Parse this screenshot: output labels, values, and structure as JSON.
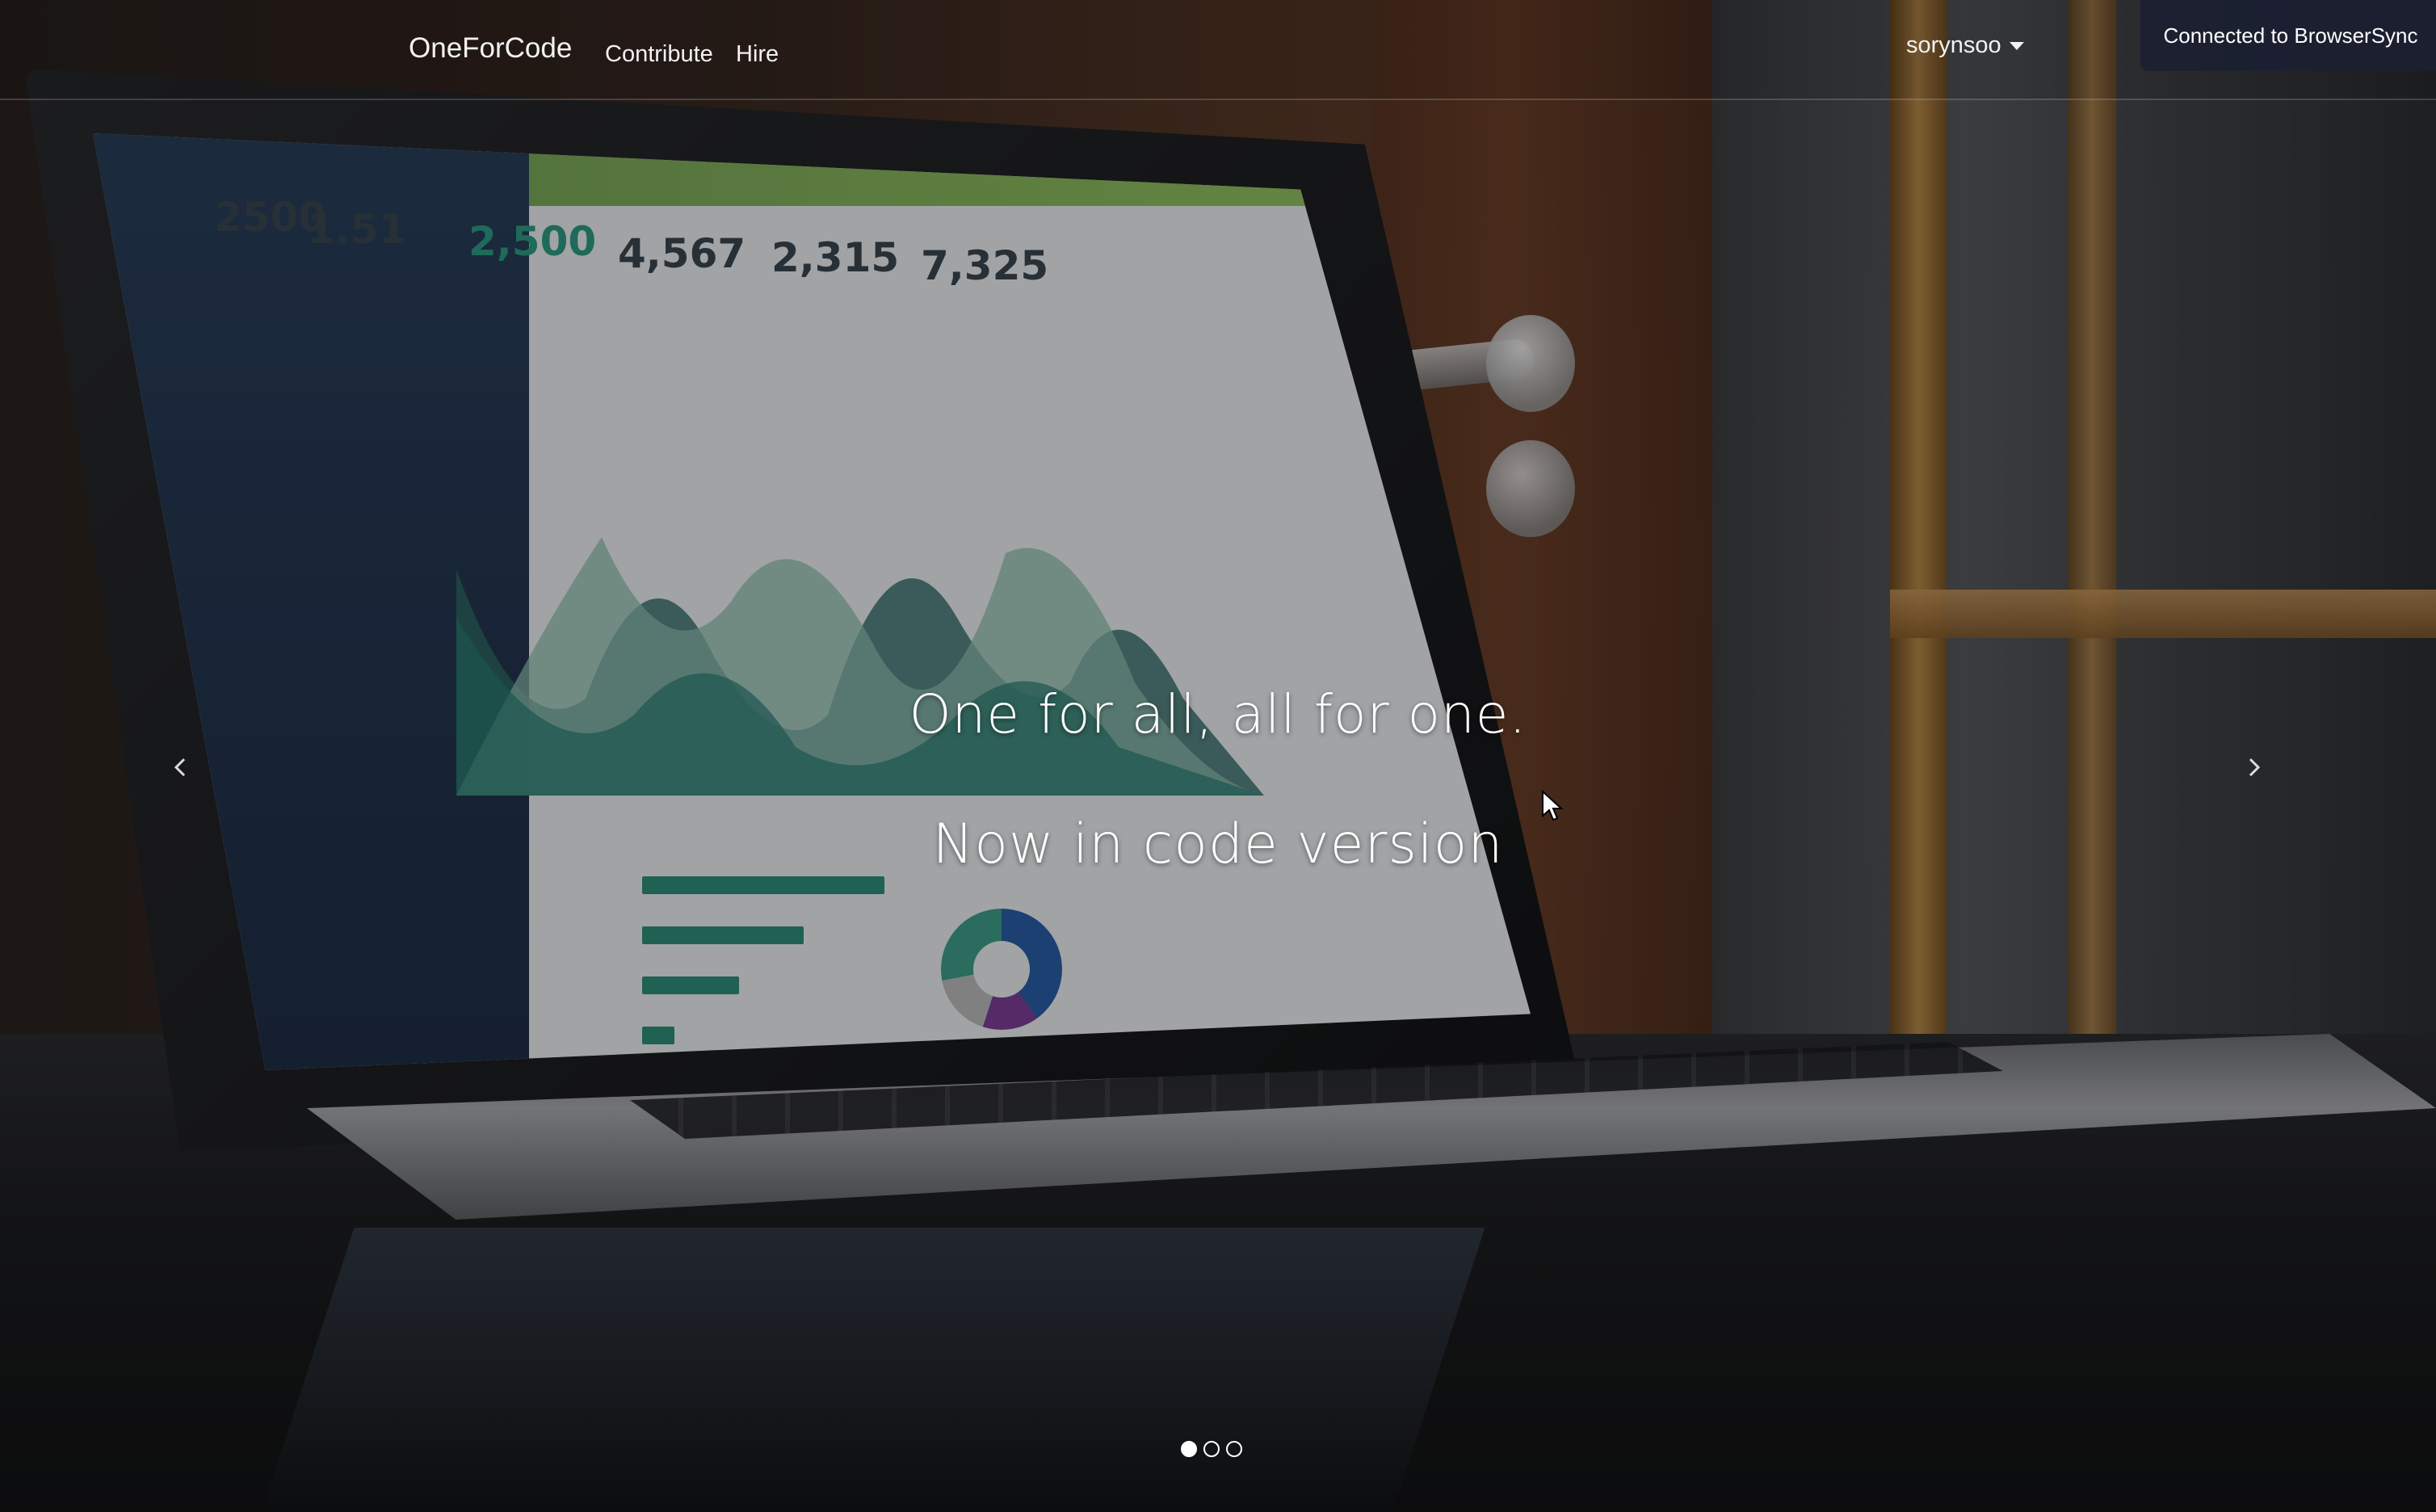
{
  "navbar": {
    "brand": "OneForCode",
    "links": [
      {
        "label": "Contribute"
      },
      {
        "label": "Hire"
      }
    ],
    "user": {
      "username": "sorynsoo"
    }
  },
  "browsersync": {
    "message": "Connected to BrowserSync"
  },
  "carousel": {
    "captions": [
      "One for all, all for one.",
      "Now in code version"
    ],
    "slide_count": 3,
    "active_index": 0,
    "prev_icon": "chevron-left-icon",
    "next_icon": "chevron-right-icon"
  },
  "background_screen_stats": [
    "2500",
    "1.51",
    "2,500",
    "4,567",
    "2,315",
    "7,325"
  ],
  "colors": {
    "nav_text": "#f2f2f2",
    "notify_bg": "#1b2032",
    "caption_text": "#ffffff"
  }
}
